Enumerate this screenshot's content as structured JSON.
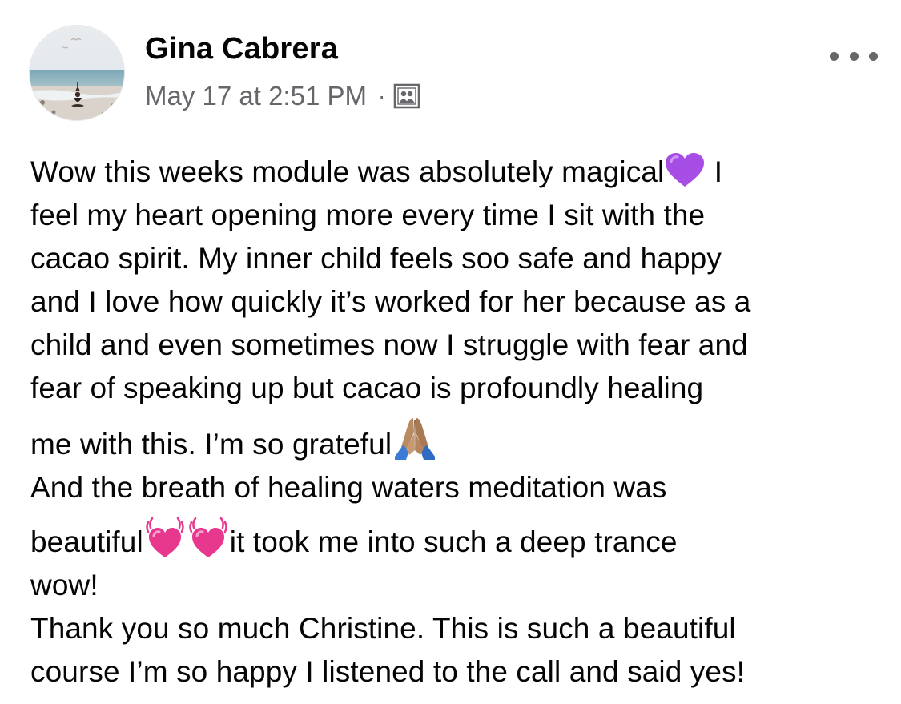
{
  "post": {
    "author": "Gina Cabrera",
    "timestamp": "May 17 at 2:51 PM",
    "separator": "·",
    "audience_icon": "group-members-icon",
    "more_icon": "more-options-icon",
    "lines": [
      {
        "text_before": "Wow this weeks module was absolutely magical",
        "emoji": "purple-heart",
        "text_after": " I"
      },
      {
        "text": "feel my heart opening more every time I sit with the"
      },
      {
        "text": "cacao spirit. My inner child feels soo safe and happy"
      },
      {
        "text": "and I love how quickly it’s worked for her because as a"
      },
      {
        "text": "child and even sometimes now I struggle with fear and"
      },
      {
        "text": "fear of speaking up but cacao is profoundly healing"
      },
      {
        "text_before": "me with this. I’m so grateful",
        "emoji": "folded-hands"
      },
      {
        "text": "And the breath of healing waters meditation was"
      },
      {
        "text_before": "beautiful",
        "emoji": "heart-with-waves",
        "text_after": "it took me into such a deep trance"
      },
      {
        "text": "wow!"
      },
      {
        "text": "Thank you so much Christine. This is such a beautiful"
      },
      {
        "text": "course I’m so happy I listened to the call and said yes!"
      }
    ]
  },
  "colors": {
    "text": "#050505",
    "secondary_text": "#65676b",
    "purple_heart": "#a64de6",
    "pink_heart": "#e8388e",
    "hands_skin": "#b98b63",
    "hands_sleeve": "#3b7bd6"
  }
}
